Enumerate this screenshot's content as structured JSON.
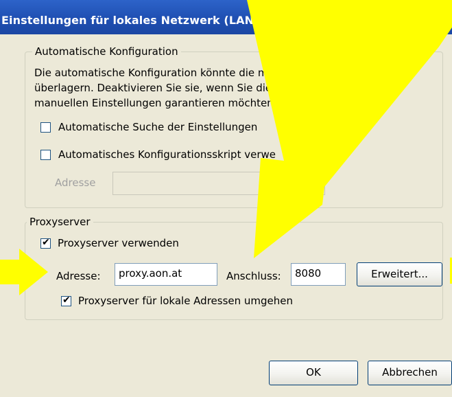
{
  "window": {
    "title": "Einstellungen für lokales Netzwerk (LAN)"
  },
  "auto_config": {
    "legend": "Automatische Konfiguration",
    "description_line1": "Die automatische Konfiguration könnte die manuell",
    "description_line2": "überlagern. Deaktivieren Sie sie, wenn Sie die Ve",
    "description_line3": "manuellen Einstellungen garantieren möchten.",
    "auto_detect": {
      "label": "Automatische Suche der Einstellungen",
      "checked": false
    },
    "auto_script": {
      "label": "Automatisches Konfigurationsskript verwe",
      "checked": false
    },
    "address_label": "Adresse",
    "address_value": ""
  },
  "proxy": {
    "legend": "Proxyserver",
    "use_proxy": {
      "label": "Proxyserver verwenden",
      "checked": true
    },
    "address_label": "Adresse:",
    "address_value": "proxy.aon.at",
    "port_label": "Anschluss:",
    "port_value": "8080",
    "advanced_button": "Erweitert...",
    "bypass_local": {
      "label": "Proxyserver für lokale Adressen umgehen",
      "checked": true
    }
  },
  "buttons": {
    "ok": "OK",
    "cancel": "Abbrechen"
  },
  "annotation_color": "#ffff00"
}
